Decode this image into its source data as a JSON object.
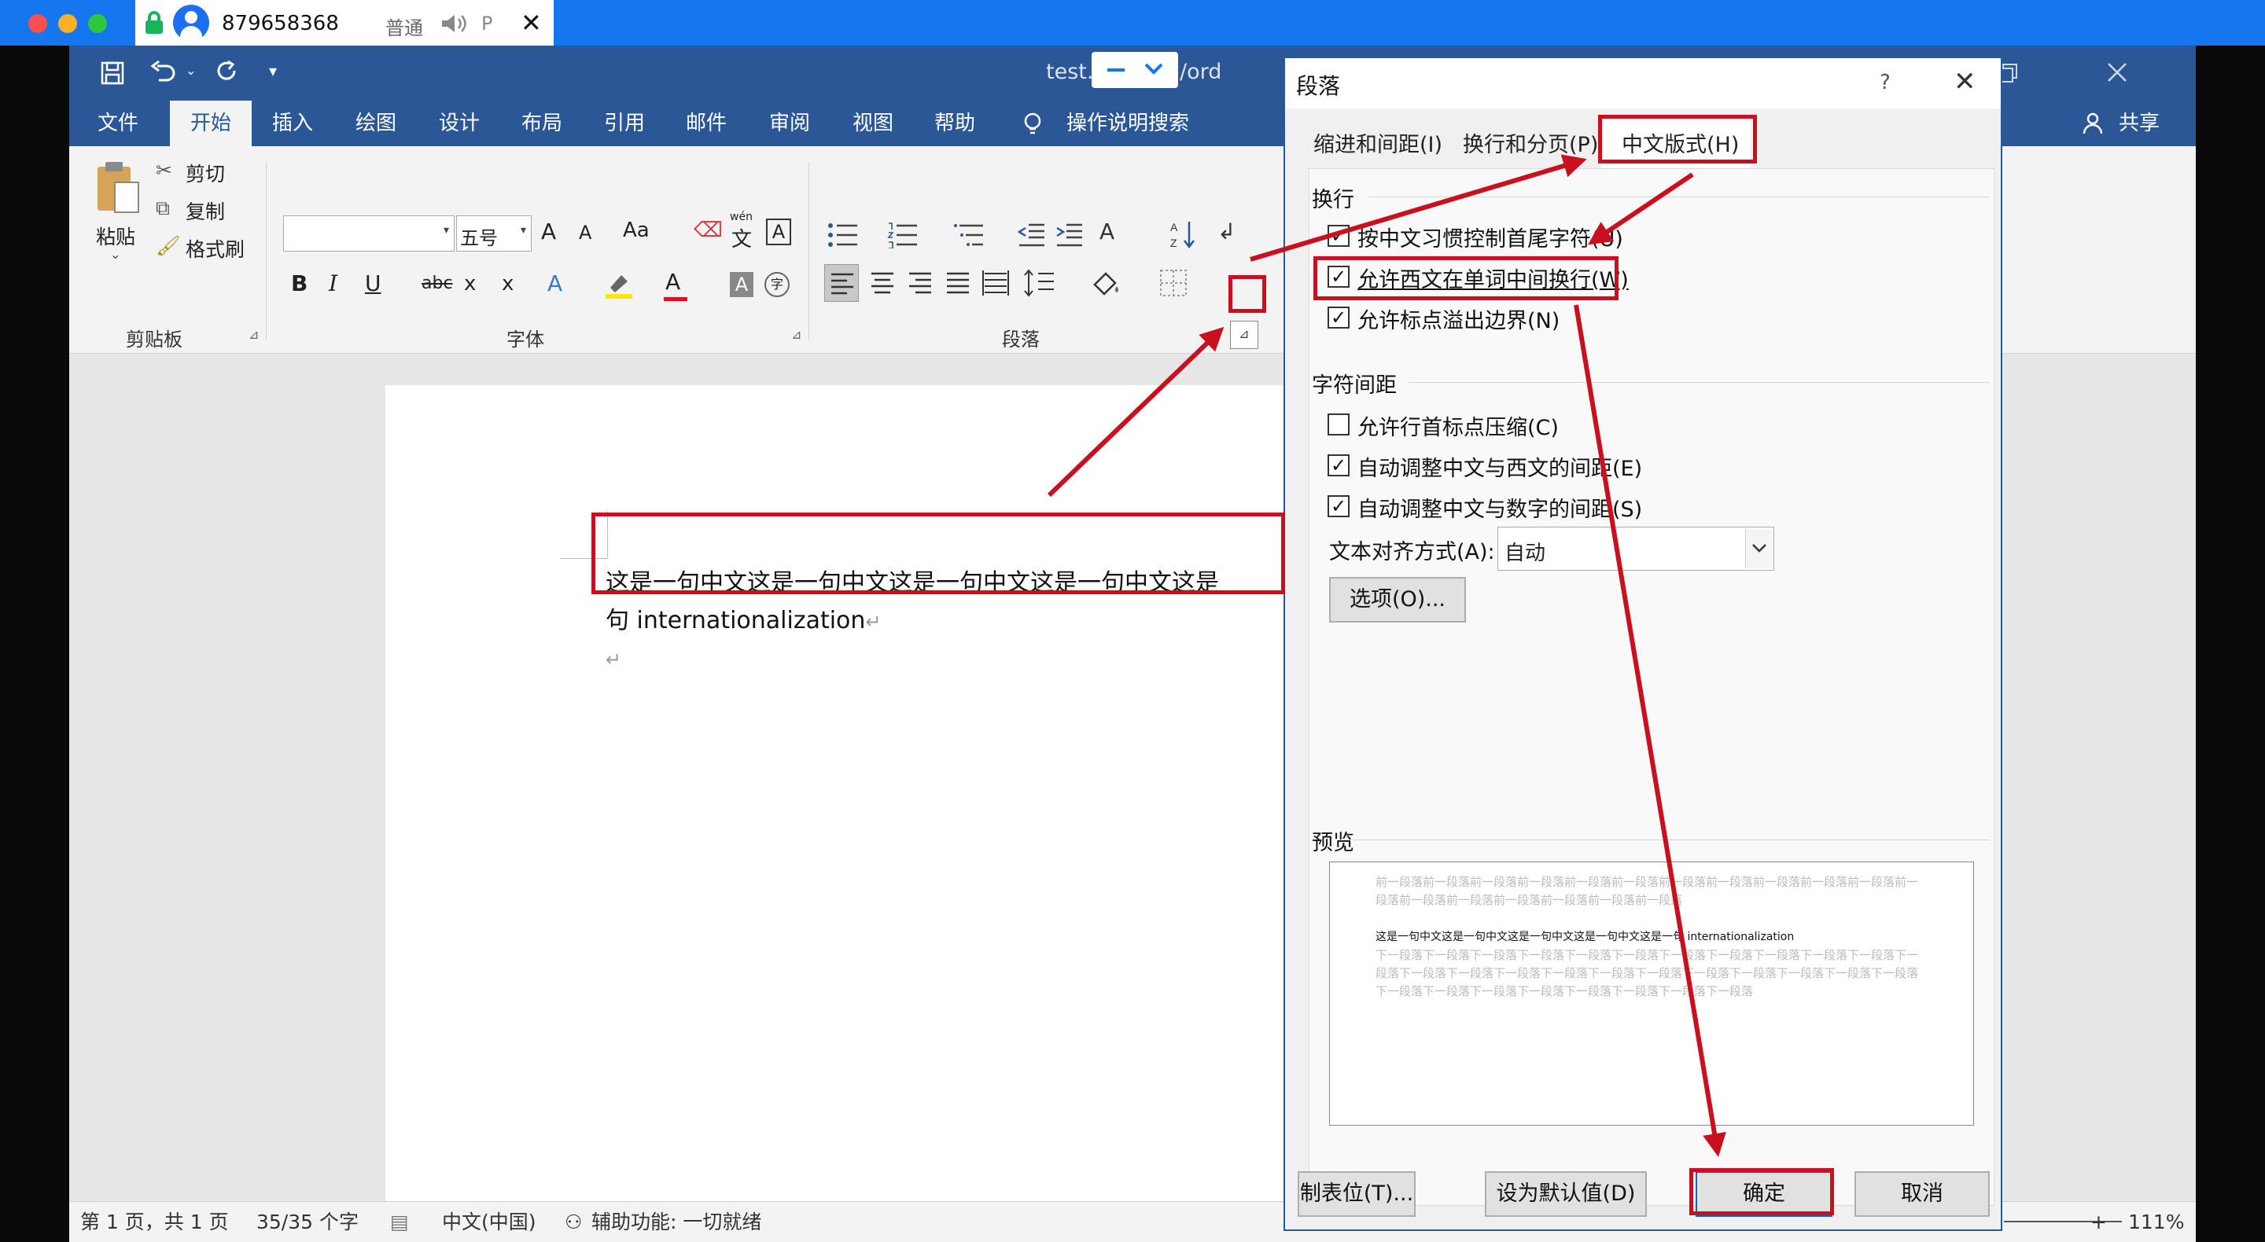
{
  "session": {
    "id": "879658368",
    "quality": "普通",
    "mode_label": "P",
    "close": "✕"
  },
  "word": {
    "title_left": "test.",
    "title_right": "/ord",
    "qat_more": "▾",
    "menu": [
      "文件",
      "开始",
      "插入",
      "绘图",
      "设计",
      "布局",
      "引用",
      "邮件",
      "审阅",
      "视图",
      "帮助"
    ],
    "search_label": "操作说明搜索",
    "share_label": "共享",
    "clipboard": {
      "paste": "粘贴",
      "cut": "剪切",
      "copy": "复制",
      "format_painter": "格式刷",
      "group": "剪贴板"
    },
    "font": {
      "font_name": "",
      "font_size": "五号",
      "group": "字体",
      "bold": "B",
      "italic": "I",
      "underline": "U",
      "strike": "abc",
      "sub": "x",
      "sup": "x",
      "grow": "A",
      "shrink": "A",
      "case": "Aa",
      "pinyin_top": "wén",
      "pinyin_char": "文",
      "border_char": "A",
      "enclose_char": "字"
    },
    "paragraph_group": "段落",
    "document_line1": "这是一句中文这是一句中文这是一句中文这是一句中文这是",
    "document_line2": "句 internationalization",
    "status": {
      "page": "第 1 页，共 1 页",
      "words": "35/35 个字",
      "lang": "中文(中国)",
      "accessibility": "辅助功能: 一切就绪",
      "zoom": "111%",
      "zoom_plus": "+"
    }
  },
  "dialog": {
    "title": "段落",
    "help": "?",
    "close": "✕",
    "tabs": [
      "缩进和间距(I)",
      "换行和分页(P)",
      "中文版式(H)"
    ],
    "section_wrap": "换行",
    "wrap_options": [
      {
        "label": "按中文习惯控制首尾字符(U)",
        "checked": true
      },
      {
        "label": "允许西文在单词中间换行(W)",
        "checked": true
      },
      {
        "label": "允许标点溢出边界(N)",
        "checked": true
      }
    ],
    "section_spacing": "字符间距",
    "spacing_options": [
      {
        "label": "允许行首标点压缩(C)",
        "checked": false
      },
      {
        "label": "自动调整中文与西文的间距(E)",
        "checked": true
      },
      {
        "label": "自动调整中文与数字的间距(S)",
        "checked": true
      }
    ],
    "align_label": "文本对齐方式(A):",
    "align_value": "自动",
    "options_button": "选项(O)...",
    "preview_label": "预览",
    "preview_prev": "前一段落前一段落前一段落前一段落前一段落前一段落前一段落前一段落前一段落前一段落前一段落前一段落前一段落前一段落前一段落前一段落前一段落前一段落",
    "preview_text": "这是一句中文这是一句中文这是一句中文这是一句中文这是一句 internationalization",
    "preview_next": "下一段落下一段落下一段落下一段落下一段落下一段落下一段落下一段落下一段落下一段落下一段落下一段落下一段落下一段落下一段落下一段落下一段落下一段落下一段落下一段落下一段落下一段落下一段落下一段落下一段落下一段落下一段落下一段落下一段落下一段落下一段落",
    "buttons": {
      "tabs": "制表位(T)...",
      "set_default": "设为默认值(D)",
      "ok": "确定",
      "cancel": "取消"
    }
  },
  "colors": {
    "session_bar": "#1577ee",
    "word_blue": "#2b5797",
    "annotation_red": "#c8101e"
  }
}
